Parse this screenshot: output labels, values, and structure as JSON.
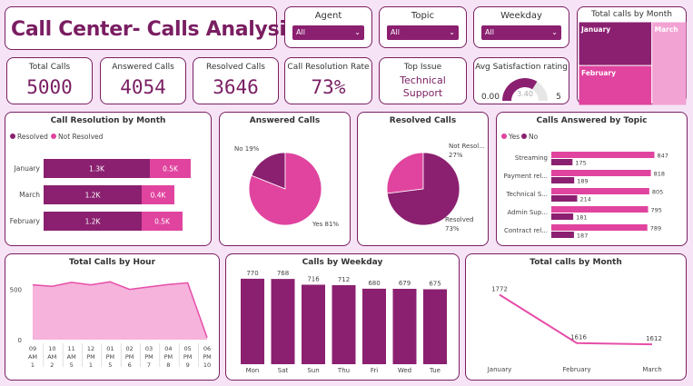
{
  "header": {
    "title": "Call Center- Calls Analysis"
  },
  "slicers": [
    {
      "label": "Agent",
      "value": "All"
    },
    {
      "label": "Topic",
      "value": "All"
    },
    {
      "label": "Weekday",
      "value": "All"
    }
  ],
  "kpis": {
    "total_calls": {
      "label": "Total Calls",
      "value": "5000"
    },
    "answered_calls": {
      "label": "Answered Calls",
      "value": "4054"
    },
    "resolved_calls": {
      "label": "Resolved Calls",
      "value": "3646"
    },
    "resolution_rate": {
      "label": "Call Resolution Rate",
      "value": "73%"
    },
    "top_issue": {
      "label": "Top Issue",
      "line1": "Technical",
      "line2": "Support"
    },
    "satisfaction": {
      "label": "Avg Satisfaction rating",
      "min": "0.00",
      "max": "5",
      "value": "3.40",
      "fraction": 0.68
    }
  },
  "colors": {
    "dark": "#8b2070",
    "pink": "#e0449f",
    "light": "#f2a3d4",
    "area": "#f6b3dc",
    "line": "#e64ea8"
  },
  "chart_data": [
    {
      "id": "treemap",
      "type": "treemap",
      "title": "Total calls by Month",
      "categories": [
        "January",
        "February",
        "March"
      ],
      "values": [
        1772,
        1616,
        1612
      ]
    },
    {
      "id": "resolution_by_month",
      "type": "bar",
      "title": "Call Resolution by Month",
      "categories": [
        "January",
        "March",
        "February"
      ],
      "series": [
        {
          "name": "Resolved",
          "values": [
            1.3,
            1.2,
            1.2
          ],
          "labels": [
            "1.3K",
            "1.2K",
            "1.2K"
          ]
        },
        {
          "name": "Not Resolved",
          "values": [
            0.5,
            0.4,
            0.5
          ],
          "labels": [
            "0.5K",
            "0.4K",
            "0.5K"
          ]
        }
      ]
    },
    {
      "id": "answered_pie",
      "type": "pie",
      "title": "Answered Calls",
      "categories": [
        "No",
        "Yes"
      ],
      "values": [
        19,
        81
      ],
      "labels": [
        "No 19%",
        "Yes 81%"
      ]
    },
    {
      "id": "resolved_pie",
      "type": "pie",
      "title": "Resolved Calls",
      "categories": [
        "Not Resolved",
        "Resolved"
      ],
      "values": [
        27,
        73
      ],
      "labels": [
        "Not Resol...",
        "27%",
        "Resolved",
        "73%"
      ]
    },
    {
      "id": "answered_by_topic",
      "type": "bar",
      "title": "Calls Answered by Topic",
      "categories": [
        "Streaming",
        "Payment rel...",
        "Technical S...",
        "Admin Sup...",
        "Contract rel..."
      ],
      "series": [
        {
          "name": "Yes",
          "values": [
            847,
            818,
            805,
            795,
            789
          ]
        },
        {
          "name": "No",
          "values": [
            175,
            189,
            214,
            181,
            187
          ]
        }
      ],
      "xlim": [
        0,
        900
      ]
    },
    {
      "id": "calls_by_hour",
      "type": "area",
      "title": "Total Calls by Hour",
      "categories": [
        "09 AM 1",
        "10 AM 2",
        "11 AM 5",
        "12 PM 1",
        "01 PM 5",
        "02 PM 6",
        "03 PM 7",
        "04 PM 8",
        "05 PM 9",
        "06 PM 10"
      ],
      "tick_lines": [
        [
          "09",
          "AM",
          "1"
        ],
        [
          "10",
          "AM",
          "2"
        ],
        [
          "11",
          "AM",
          "5"
        ],
        [
          "12",
          "PM",
          "1"
        ],
        [
          "01",
          "PM",
          "5"
        ],
        [
          "02",
          "PM",
          "6"
        ],
        [
          "03",
          "PM",
          "7"
        ],
        [
          "04",
          "PM",
          "8"
        ],
        [
          "05",
          "PM",
          "9"
        ],
        [
          "06",
          "PM",
          "10"
        ]
      ],
      "values": [
        545,
        530,
        570,
        545,
        575,
        500,
        525,
        548,
        565,
        20
      ],
      "yticks": [
        0,
        500
      ],
      "ylim": [
        0,
        650
      ]
    },
    {
      "id": "calls_by_weekday",
      "type": "bar",
      "title": "Calls by Weekday",
      "categories": [
        "Mon",
        "Sat",
        "Sun",
        "Thu",
        "Fri",
        "Wed",
        "Tue"
      ],
      "values": [
        770,
        768,
        716,
        712,
        680,
        679,
        675
      ],
      "ylim": [
        0,
        900
      ]
    },
    {
      "id": "calls_by_month_line",
      "type": "line",
      "title": "Total calls by Month",
      "categories": [
        "January",
        "February",
        "March"
      ],
      "values": [
        1772,
        1616,
        1612
      ],
      "ylim": [
        1580,
        1800
      ]
    }
  ]
}
